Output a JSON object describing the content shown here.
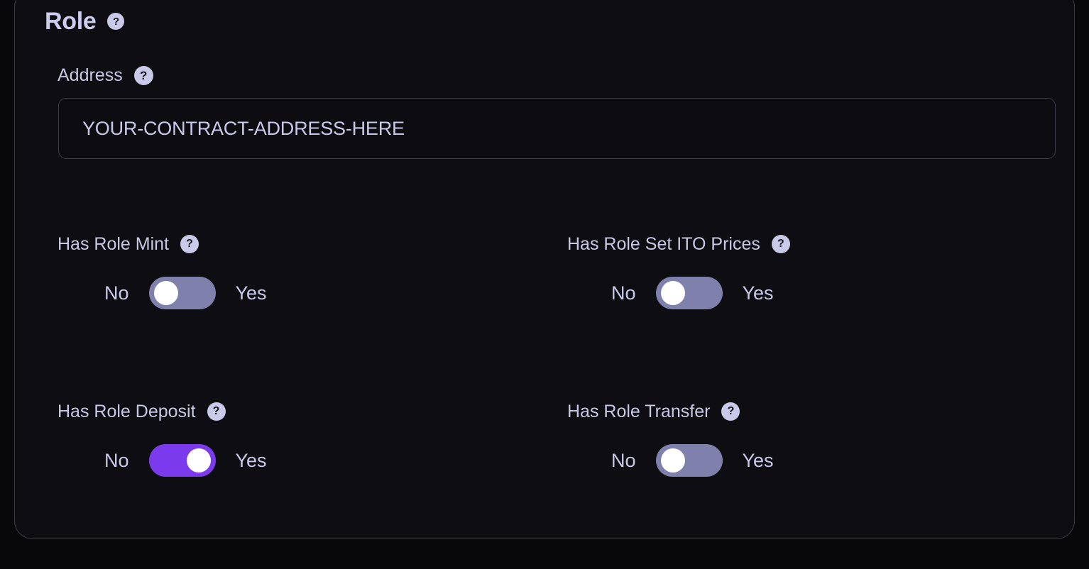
{
  "card": {
    "title": "Role",
    "help_glyph": "?",
    "help_icon_name": "help-icon"
  },
  "address": {
    "label": "Address",
    "value": "YOUR-CONTRACT-ADDRESS-HERE",
    "placeholder": "YOUR-CONTRACT-ADDRESS-HERE"
  },
  "toggle_labels": {
    "off": "No",
    "on": "Yes"
  },
  "colors": {
    "card_background": "#0d0d12",
    "card_border": "#3a3a44",
    "page_background": "#08080b",
    "text_primary": "#c9c9ea",
    "accent_on": "#7c3aed",
    "track_off": "#7f81ac",
    "knob": "#ffffff",
    "help_badge": "#c9c9ea"
  },
  "toggles": [
    {
      "label": "Has Role Mint",
      "state": "No",
      "on": false
    },
    {
      "label": "Has Role Set ITO Prices",
      "state": "No",
      "on": false
    },
    {
      "label": "Has Role Deposit",
      "state": "Yes",
      "on": true
    },
    {
      "label": "Has Role Transfer",
      "state": "No",
      "on": false
    }
  ]
}
